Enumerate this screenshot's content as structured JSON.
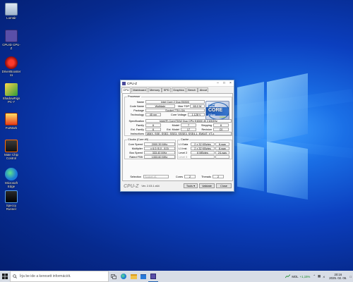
{
  "desktop": {
    "icons": [
      {
        "label": "Lomtár",
        "icon": "recycle-bin-icon"
      },
      {
        "label": "CPUID CPU-Z",
        "icon": "cpuz-icon"
      },
      {
        "label": "DriverBooster 11",
        "icon": "driverbooster-icon"
      },
      {
        "label": "ShadowRigs PC-7",
        "icon": "shadowrigs-icon"
      },
      {
        "label": "FurMark",
        "icon": "furmark-icon"
      },
      {
        "label": "Mate Chip Control",
        "icon": "mate-chip-icon"
      },
      {
        "label": "Microsoft Edge",
        "icon": "edge-icon"
      },
      {
        "label": "Speccy Runner",
        "icon": "speccy-icon"
      }
    ]
  },
  "window": {
    "title": "CPU-Z",
    "tabs": [
      "CPU",
      "Mainboard",
      "Memory",
      "SPD",
      "Graphics",
      "Bench",
      "About"
    ],
    "active_tab": "CPU",
    "processor": {
      "group_label": "Processor",
      "name_label": "Name",
      "name": "Intel Core 2 Duo E8300",
      "codename_label": "Code Name",
      "codename": "Wolfdale",
      "maxtdp_label": "Max TDP",
      "maxtdp": "65.0 W",
      "package_label": "Package",
      "package": "Socket 775 LGA",
      "technology_label": "Technology",
      "technology": "45 nm",
      "corevoltage_label": "Core Voltage",
      "corevoltage": "1.128 V",
      "spec_label": "Specification",
      "spec": "Intel(R) Core(TM)2 Duo CPU    E8300  @ 2.83GHz",
      "family_label": "Family",
      "family": "6",
      "model_label": "Model",
      "model": "7",
      "stepping_label": "Stepping",
      "stepping": "6",
      "extfamily_label": "Ext. Family",
      "extfamily": "6",
      "extmodel_label": "Ext. Model",
      "extmodel": "17",
      "revision_label": "Revision",
      "revision": "C0",
      "instructions_label": "Instructions",
      "instructions": "MMX, SSE, SSE2, SSE3, SSSE3, SSE4.1, EM64T, VT-x"
    },
    "logo": {
      "brand": "intel",
      "line": "CORE",
      "sub": "2 Duo",
      "tag": "inside"
    },
    "clocks": {
      "group_label": "Clocks (Core #0)",
      "corespeed_label": "Core Speed",
      "corespeed": "2000.39 MHz",
      "multiplier_label": "Multiplier",
      "multiplier": "x 6.0 (6.0 - 8.5)",
      "busspeed_label": "Bus Speed",
      "busspeed": "333.40 MHz",
      "ratedfsb_label": "Rated FSB",
      "ratedfsb": "1333.60 MHz"
    },
    "cache": {
      "group_label": "Cache",
      "l1data_label": "L1 Data",
      "l1data": "2 x 32 KBytes",
      "l1data_way": "8-way",
      "l1inst_label": "L1 Inst.",
      "l1inst": "2 x 32 KBytes",
      "l1inst_way": "8-way",
      "level2_label": "Level 2",
      "level2": "6 MBytes",
      "level2_way": "24-way",
      "level3_label": "Level 3",
      "level3": "",
      "level3_way": ""
    },
    "selection": {
      "label": "Selection",
      "value": "Socket #1",
      "cores_label": "Cores",
      "cores": "2",
      "threads_label": "Threads",
      "threads": "2"
    },
    "footer": {
      "brand": "CPU-Z",
      "version": "Ver. 2.03.1.x64",
      "tools_label": "Tools",
      "validate_label": "Validate",
      "close_label": "Close"
    }
  },
  "taskbar": {
    "search_placeholder": "Írja be ide a keresett információt.",
    "stock_name": "MOL",
    "stock_change": "+1,15%",
    "time": "20:16",
    "date": "2025. 02. 06."
  },
  "colors": {
    "accent": "#1d5fb0",
    "stock_up": "#1a8a2a"
  }
}
